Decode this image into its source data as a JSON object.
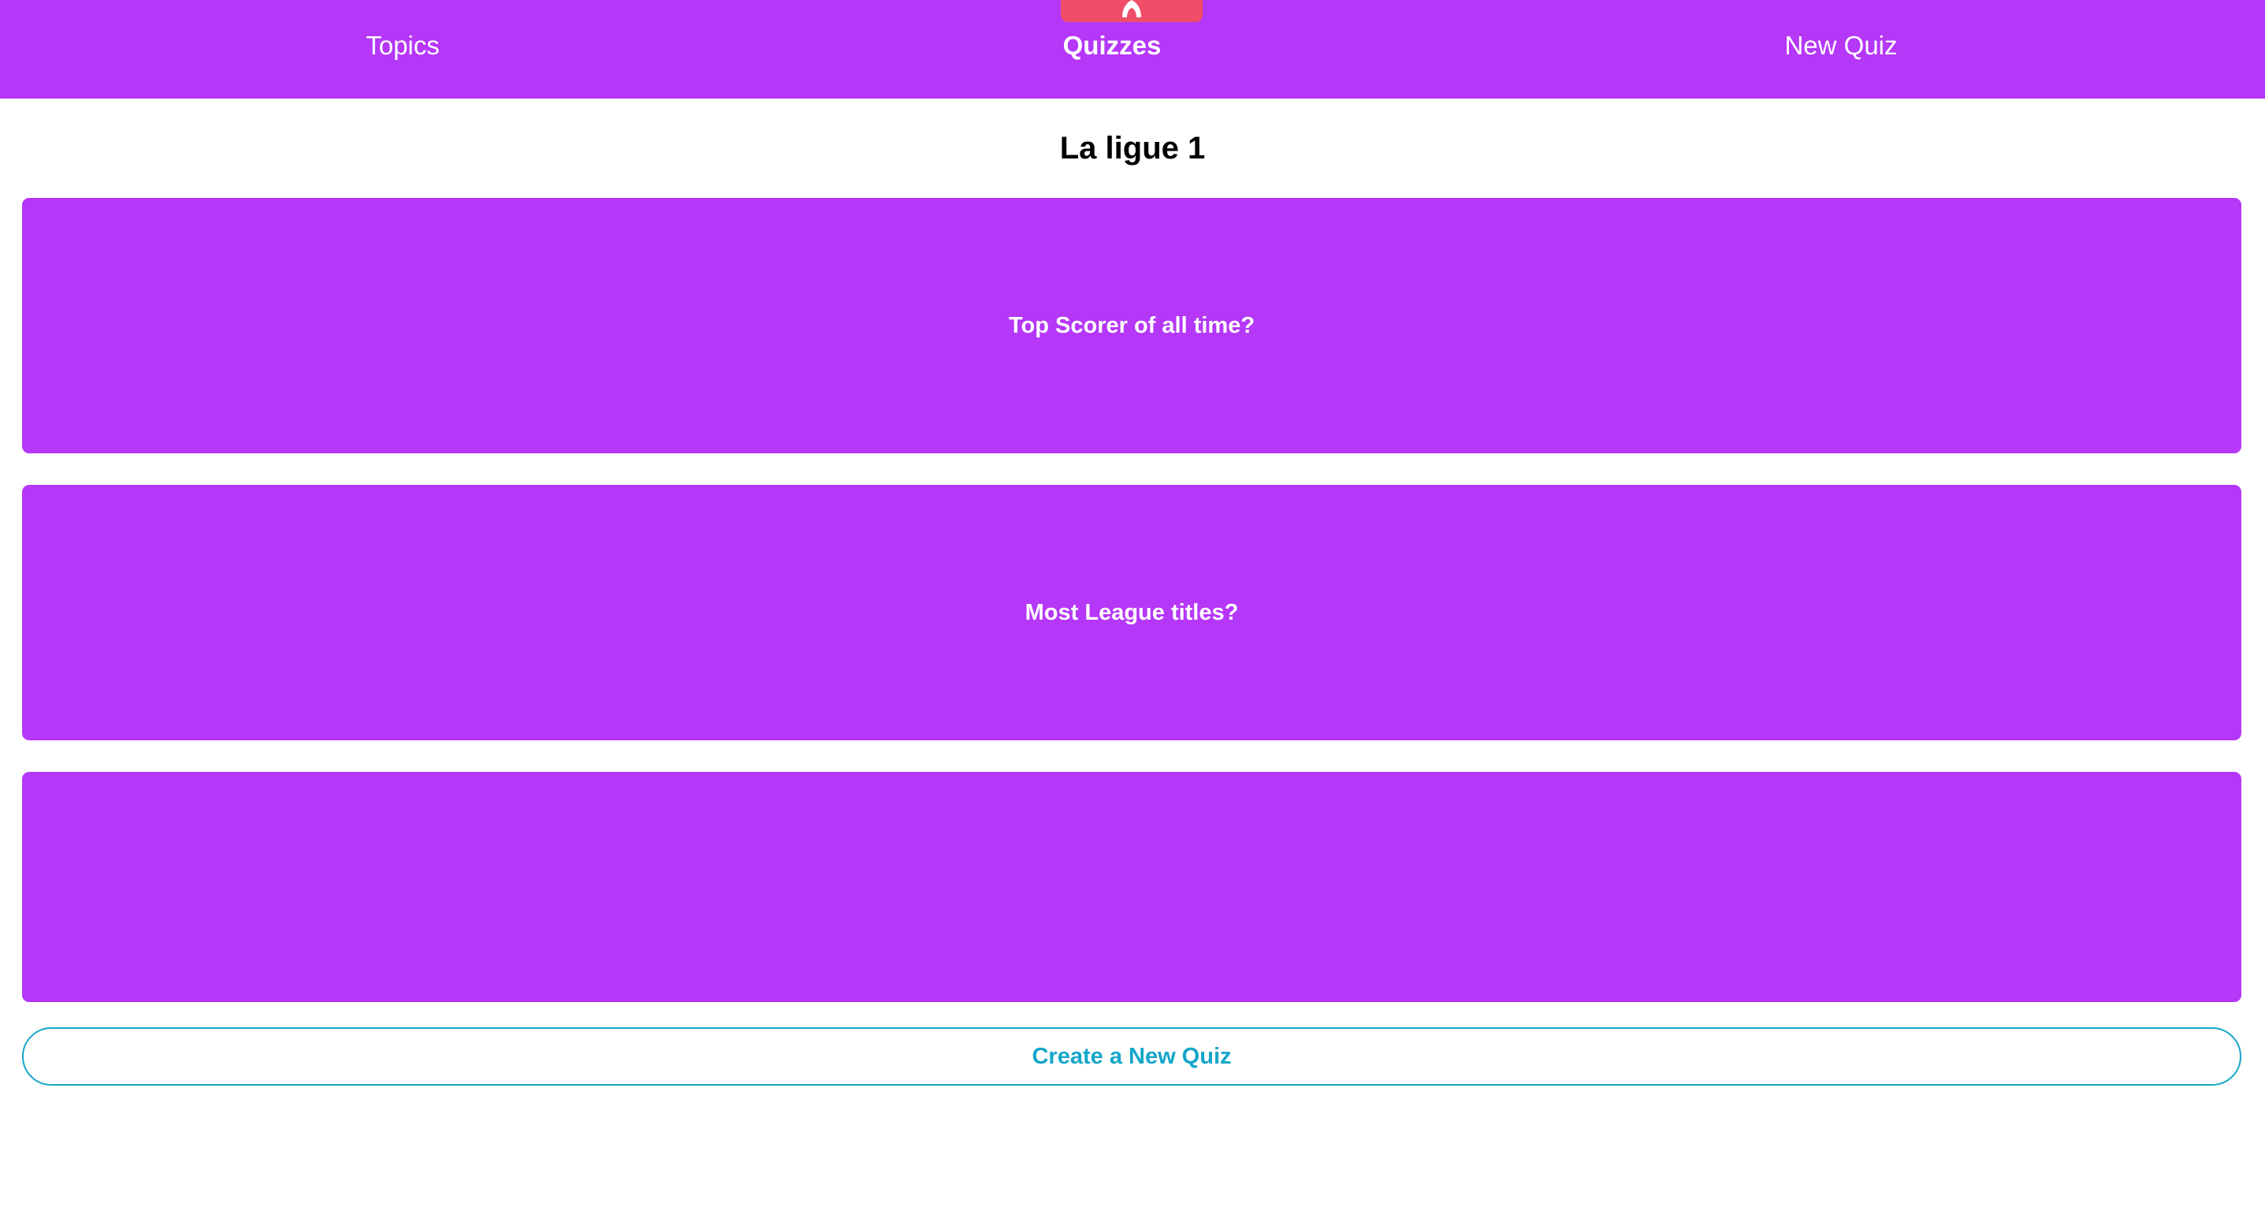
{
  "nav": {
    "items": [
      {
        "label": "Topics",
        "active": false
      },
      {
        "label": "Quizzes",
        "active": true
      },
      {
        "label": "New Quiz",
        "active": false
      }
    ],
    "logo_icon": "flame-icon"
  },
  "page": {
    "title": "La ligue 1"
  },
  "quizzes": [
    {
      "name": "Top Scorer of all time?"
    },
    {
      "name": "Most League titles?"
    },
    {
      "name": ""
    }
  ],
  "actions": {
    "create_label": "Create a New Quiz"
  },
  "colors": {
    "primary": "#b537f8",
    "logo_background": "#f04e68",
    "accent": "#14a6c8",
    "background": "#ffffff"
  }
}
